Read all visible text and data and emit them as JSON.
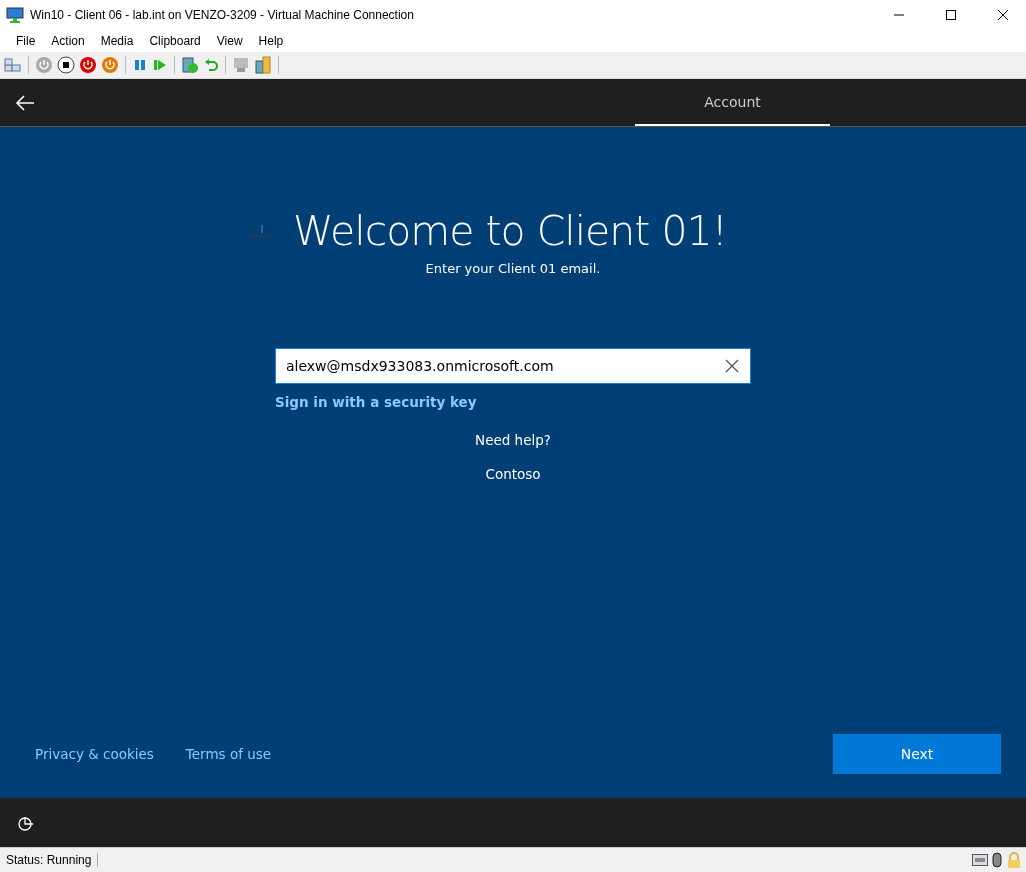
{
  "window": {
    "title": "Win10 - Client 06 - lab.int on VENZO-3209 - Virtual Machine Connection"
  },
  "menu": [
    "File",
    "Action",
    "Media",
    "Clipboard",
    "View",
    "Help"
  ],
  "header": {
    "tabs": [
      {
        "label": "Account",
        "selected": true
      }
    ]
  },
  "signin": {
    "title": "Welcome to Client 01!",
    "subtitle": "Enter your Client 01 email.",
    "email": {
      "value": "alexw@msdx933083.onmicrosoft.com"
    },
    "security_key_link": "Sign in with a security key",
    "help": "Need help?",
    "org": "Contoso"
  },
  "footer": {
    "links": [
      "Privacy & cookies",
      "Terms of use"
    ],
    "next_button": "Next"
  },
  "status_bar": {
    "status": "Status: Running"
  }
}
